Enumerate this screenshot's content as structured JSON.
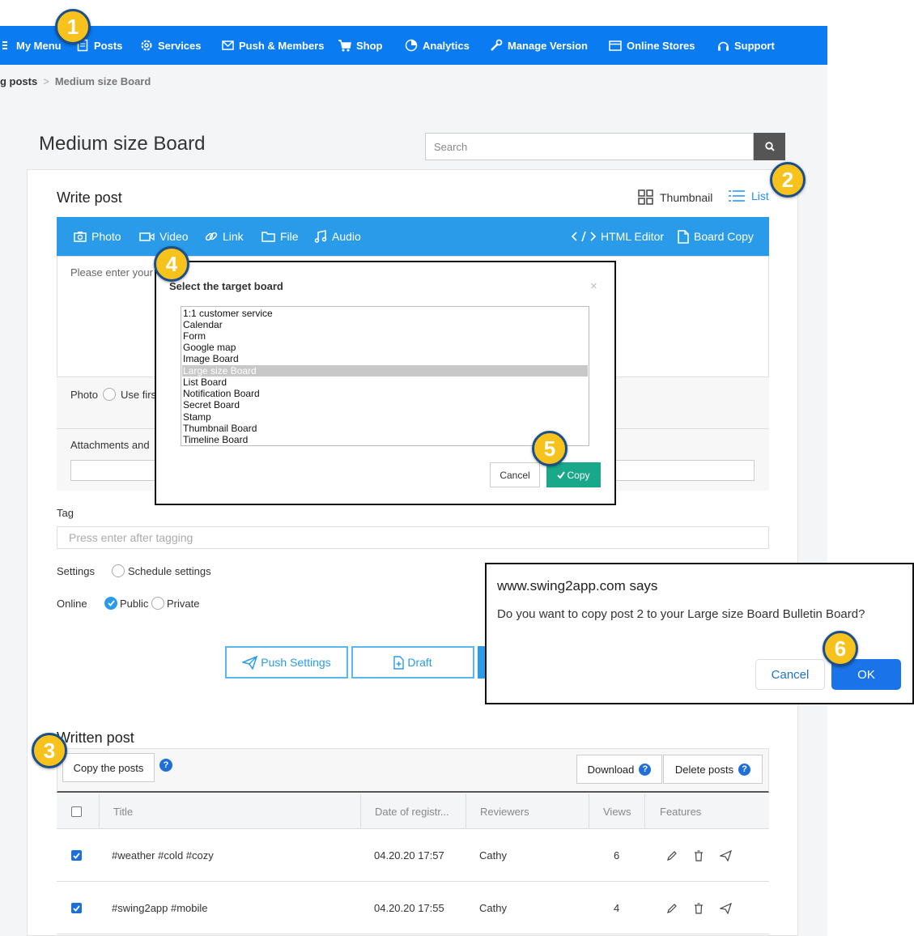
{
  "nav": {
    "items": [
      {
        "label": "My Menu",
        "icon": "menu-icon"
      },
      {
        "label": "Posts",
        "icon": "document-icon"
      },
      {
        "label": "Services",
        "icon": "gear-icon"
      },
      {
        "label": "Push & Members",
        "icon": "mail-icon"
      },
      {
        "label": "Shop",
        "icon": "cart-icon"
      },
      {
        "label": "Analytics",
        "icon": "pie-chart-icon"
      },
      {
        "label": "Manage Version",
        "icon": "wrench-icon"
      },
      {
        "label": "Online Stores",
        "icon": "window-icon"
      },
      {
        "label": "Support",
        "icon": "headset-icon"
      }
    ],
    "accent": "#0a7bf0"
  },
  "breadcrumb": {
    "first": "g posts",
    "separator": ">",
    "current": "Medium size Board"
  },
  "page": {
    "title": "Medium size Board",
    "search_placeholder": "Search"
  },
  "write_post": {
    "title": "Write post",
    "view_thumbnail": "Thumbnail",
    "view_list": "List",
    "toolbar": {
      "photo": "Photo",
      "video": "Video",
      "link": "Link",
      "file": "File",
      "audio": "Audio",
      "html_editor": "HTML Editor",
      "board_copy": "Board Copy"
    },
    "editor_placeholder": "Please enter your",
    "photo_label": "Photo",
    "photo_option": "Use firs",
    "attachments_label": "Attachments and",
    "tag_label": "Tag",
    "tag_placeholder": "Press enter after tagging",
    "settings_label": "Settings",
    "schedule_settings": "Schedule settings",
    "online_label": "Online",
    "public": "Public",
    "private": "Private",
    "push_settings": "Push Settings",
    "draft": "Draft"
  },
  "modal": {
    "title": "Select the target board",
    "close": "×",
    "boards": [
      "1:1 customer service",
      "Calendar",
      "Form",
      "Google map",
      "Image Board",
      "Large size Board",
      "List Board",
      "Notification Board",
      "Secret Board",
      "Stamp",
      "Thumbnail Board",
      "Timeline Board"
    ],
    "selected": "Large size Board",
    "cancel": "Cancel",
    "copy": "Copy"
  },
  "confirm": {
    "title": "www.swing2app.com says",
    "message": "Do you want to copy post 2 to your Large size Board Bulletin Board?",
    "cancel": "Cancel",
    "ok": "OK"
  },
  "written_post": {
    "title": "Written post",
    "copy_posts": "Copy the posts",
    "download": "Download",
    "delete_posts": "Delete posts",
    "help_glyph": "?",
    "columns": [
      "Title",
      "Date of registr...",
      "Reviewers",
      "Views",
      "Features"
    ],
    "rows": [
      {
        "checked": true,
        "title": "#weather #cold #cozy",
        "date": "04.20.20 17:57",
        "reviewer": "Cathy",
        "views": "6"
      },
      {
        "checked": true,
        "title": "#swing2app #mobile",
        "date": "04.20.20 17:55",
        "reviewer": "Cathy",
        "views": "4"
      }
    ]
  },
  "steps": [
    "1",
    "2",
    "3",
    "4",
    "5",
    "6"
  ]
}
